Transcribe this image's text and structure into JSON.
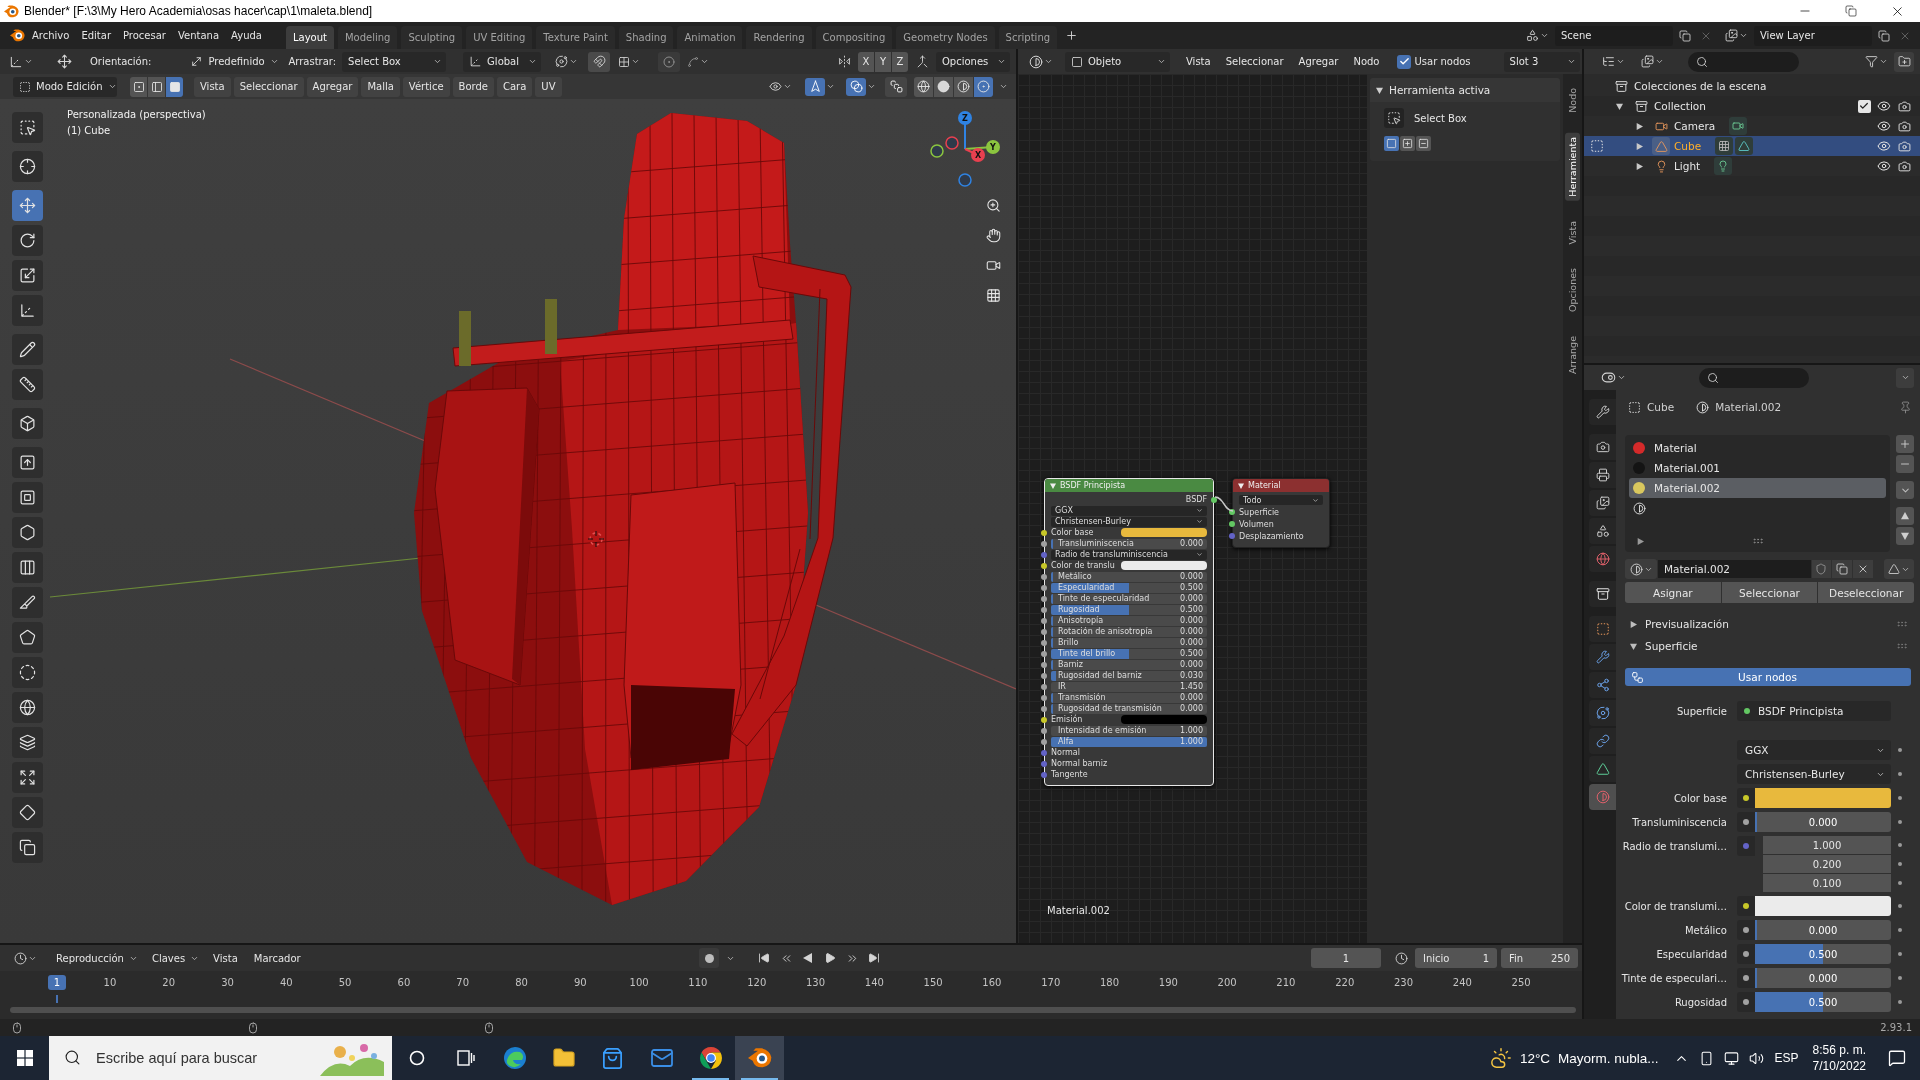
{
  "window": {
    "title": "Blender* [F:\\3\\My Hero Academia\\osas hacer\\cap\\1\\maleta.blend]"
  },
  "top_bar": {
    "menus": [
      "Archivo",
      "Editar",
      "Procesar",
      "Ventana",
      "Ayuda"
    ],
    "workspaces": [
      {
        "label": "Layout",
        "selected": true
      },
      {
        "label": "Modeling",
        "selected": false
      },
      {
        "label": "Sculpting",
        "selected": false
      },
      {
        "label": "UV Editing",
        "selected": false
      },
      {
        "label": "Texture Paint",
        "selected": false
      },
      {
        "label": "Shading",
        "selected": false
      },
      {
        "label": "Animation",
        "selected": false
      },
      {
        "label": "Rendering",
        "selected": false
      },
      {
        "label": "Compositing",
        "selected": false
      },
      {
        "label": "Geometry Nodes",
        "selected": false
      },
      {
        "label": "Scripting",
        "selected": false
      }
    ],
    "scene": "Scene",
    "view_layer": "View Layer"
  },
  "viewport": {
    "tool_settings": {
      "orientation_label": "Orientación:",
      "pivot": "Predefinido",
      "drag_label": "Arrastrar:",
      "drag": "Select Box",
      "orientation": "Global",
      "snap": false,
      "proportional": false,
      "mirror_axes": [
        {
          "label": "X",
          "selected": false
        },
        {
          "label": "Y",
          "selected": false
        },
        {
          "label": "Z",
          "selected": false
        }
      ],
      "options": "Opciones"
    },
    "header": {
      "mode": "Modo Edición",
      "select_modes": [
        {
          "kind": "vertex",
          "selected": false
        },
        {
          "kind": "edge",
          "selected": false
        },
        {
          "kind": "face",
          "selected": true
        }
      ],
      "menus": [
        "Vista",
        "Seleccionar",
        "Agregar",
        "Malla",
        "Vértice",
        "Borde",
        "Cara",
        "UV"
      ],
      "toggles": [
        {
          "kind": "gizmo",
          "on": true
        },
        {
          "kind": "overlay",
          "on": true
        },
        {
          "kind": "xray",
          "on": false
        }
      ],
      "shading": [
        {
          "kind": "wireframe",
          "selected": false
        },
        {
          "kind": "solid",
          "selected": false
        },
        {
          "kind": "material",
          "selected": false
        },
        {
          "kind": "rendered",
          "selected": true
        }
      ]
    },
    "overlay": {
      "view": "Personalizada (perspectiva)",
      "object": "(1) Cube"
    },
    "tool_groups": [
      [
        {
          "kind": "select_box",
          "selected": false
        }
      ],
      [
        {
          "kind": "cursor",
          "selected": false
        }
      ],
      [
        {
          "kind": "move",
          "selected": true
        },
        {
          "kind": "rotate",
          "selected": false
        },
        {
          "kind": "scale",
          "selected": false
        },
        {
          "kind": "transform",
          "selected": false
        }
      ],
      [
        {
          "kind": "annotate",
          "selected": false
        },
        {
          "kind": "measure",
          "selected": false
        }
      ],
      [
        {
          "kind": "add_cube",
          "selected": false
        }
      ],
      [
        {
          "kind": "extrude",
          "selected": false
        },
        {
          "kind": "inset",
          "selected": false
        },
        {
          "kind": "bevel",
          "selected": false
        },
        {
          "kind": "loop_cut",
          "selected": false
        },
        {
          "kind": "knife",
          "selected": false
        },
        {
          "kind": "poly_build",
          "selected": false
        },
        {
          "kind": "spin",
          "selected": false
        },
        {
          "kind": "smooth",
          "selected": false
        },
        {
          "kind": "edge_slide",
          "selected": false
        },
        {
          "kind": "shrink",
          "selected": false
        },
        {
          "kind": "shear",
          "selected": false
        },
        {
          "kind": "rip",
          "selected": false
        }
      ]
    ],
    "gizmo_axes": [
      {
        "label": "Z",
        "color": "#2f83e3"
      },
      {
        "label": "Y",
        "color": "#8bc53f"
      },
      {
        "label": "X",
        "color": "#e8404f"
      }
    ]
  },
  "node_editor": {
    "header": {
      "shader_type": "Objeto",
      "menus": [
        "Vista",
        "Seleccionar",
        "Agregar",
        "Nodo"
      ],
      "use_nodes": {
        "label": "Usar nodos",
        "checked": true
      },
      "slot": "Slot 3"
    },
    "nodes": [
      {
        "kind": "shader",
        "title": "BSDF Principista",
        "selected": true,
        "rows": [
          {
            "kind": "output",
            "label": "BSDF",
            "color": "#63c763"
          },
          {
            "kind": "dropdown",
            "label": "GGX"
          },
          {
            "kind": "dropdown",
            "label": "Christensen-Burley"
          },
          {
            "kind": "color",
            "label": "Color base",
            "color": "#c7c729",
            "swatch": {
              "color": "#e8b93d"
            }
          },
          {
            "kind": "slider",
            "label": "Transluminiscencia",
            "value": "0.000",
            "level": 0,
            "color": "#a1a1a1"
          },
          {
            "kind": "dropdown",
            "label": "Radio de transluminiscencia",
            "color": "#6363c7"
          },
          {
            "kind": "color",
            "label": "Color de translu",
            "color": "#c7c729",
            "swatch": {
              "color": "#ebebeb"
            }
          },
          {
            "kind": "slider",
            "label": "Metálico",
            "value": "0.000",
            "level": 0,
            "color": "#a1a1a1"
          },
          {
            "kind": "slider",
            "label": "Especularidad",
            "value": "0.500",
            "level": 0.5,
            "color": "#a1a1a1"
          },
          {
            "kind": "slider",
            "label": "Tinte de especularidad",
            "value": "0.000",
            "level": 0,
            "color": "#a1a1a1"
          },
          {
            "kind": "slider",
            "label": "Rugosidad",
            "value": "0.500",
            "level": 0.5,
            "color": "#a1a1a1"
          },
          {
            "kind": "slider",
            "label": "Anisotropía",
            "value": "0.000",
            "level": 0,
            "color": "#a1a1a1"
          },
          {
            "kind": "slider",
            "label": "Rotación de anisotropía",
            "value": "0.000",
            "level": 0,
            "color": "#a1a1a1"
          },
          {
            "kind": "slider",
            "label": "Brillo",
            "value": "0.000",
            "level": 0,
            "color": "#a1a1a1"
          },
          {
            "kind": "slider",
            "label": "Tinte del brillo",
            "value": "0.500",
            "level": 0.5,
            "color": "#a1a1a1"
          },
          {
            "kind": "slider",
            "label": "Barniz",
            "value": "0.000",
            "level": 0,
            "color": "#a1a1a1"
          },
          {
            "kind": "slider",
            "label": "Rugosidad del barniz",
            "value": "0.030",
            "level": 0.03,
            "color": "#a1a1a1"
          },
          {
            "kind": "number",
            "label": "IR",
            "value": "1.450",
            "color": "#a1a1a1"
          },
          {
            "kind": "slider",
            "label": "Transmisión",
            "value": "0.000",
            "level": 0,
            "color": "#a1a1a1"
          },
          {
            "kind": "slider",
            "label": "Rugosidad de transmisión",
            "value": "0.000",
            "level": 0,
            "color": "#a1a1a1"
          },
          {
            "kind": "color",
            "label": "Emisión",
            "color": "#c7c729",
            "swatch": {
              "color": "#000000"
            }
          },
          {
            "kind": "number",
            "label": "Intensidad de emisión",
            "value": "1.000",
            "color": "#a1a1a1"
          },
          {
            "kind": "slider",
            "label": "Alfa",
            "value": "1.000",
            "level": 1,
            "color": "#a1a1a1"
          },
          {
            "kind": "input",
            "label": "Normal",
            "color": "#6363c7"
          },
          {
            "kind": "input",
            "label": "Normal barniz",
            "color": "#6363c7"
          },
          {
            "kind": "input",
            "label": "Tangente",
            "color": "#6363c7"
          }
        ]
      },
      {
        "kind": "output",
        "title": "Material",
        "selected": false,
        "rows": [
          {
            "kind": "dropdown",
            "label": "Todo"
          },
          {
            "kind": "input",
            "label": "Superficie",
            "color": "#63c763"
          },
          {
            "kind": "input",
            "label": "Volumen",
            "color": "#63c763"
          },
          {
            "kind": "input",
            "label": "Desplazamiento",
            "color": "#6363c7"
          }
        ]
      }
    ],
    "material": "Material.002",
    "sidebar": {
      "panel_title": "Herramienta activa",
      "expanded": true,
      "tool": "Select Box",
      "modes": [
        {
          "kind": "set",
          "selected": true
        },
        {
          "kind": "extend",
          "selected": false
        },
        {
          "kind": "subtract",
          "selected": false
        }
      ]
    },
    "tabs": [
      {
        "label": "Nodo",
        "selected": false
      },
      {
        "label": "Herramienta",
        "selected": true
      },
      {
        "label": "Vista",
        "selected": false
      },
      {
        "label": "Opciones",
        "selected": false
      },
      {
        "label": "Arrange",
        "selected": false
      }
    ]
  },
  "timeline": {
    "menus": [
      {
        "label": "Reproducción",
        "kind": "dropdown"
      },
      {
        "label": "Claves",
        "kind": "dropdown"
      },
      {
        "label": "Vista",
        "kind": "menu"
      },
      {
        "label": "Marcador",
        "kind": "menu"
      }
    ],
    "auto_keying": false,
    "current_frame": "1",
    "start_label": "Inicio",
    "start": "1",
    "end_label": "Fin",
    "end": "250",
    "playhead": "1",
    "ruler": [
      "10",
      "20",
      "30",
      "40",
      "50",
      "60",
      "70",
      "80",
      "90",
      "100",
      "110",
      "120",
      "130",
      "140",
      "150",
      "160",
      "170",
      "180",
      "190",
      "200",
      "210",
      "220",
      "230",
      "240",
      "250"
    ]
  },
  "outliner": {
    "tree": [
      {
        "label": "Colecciones de la escena",
        "kind": "scene_collection",
        "selected": false,
        "children": [
          {
            "label": "Collection",
            "kind": "collection",
            "expanded": true,
            "included": true,
            "visible": true,
            "selected": false,
            "children": [
              {
                "label": "Camera",
                "kind": "camera",
                "expanded": false,
                "selected": false,
                "edit_mode": false,
                "visible": true
              },
              {
                "label": "Cube",
                "kind": "mesh",
                "expanded": false,
                "selected": true,
                "edit_mode": true,
                "visible": true
              },
              {
                "label": "Light",
                "kind": "light",
                "expanded": false,
                "selected": false,
                "edit_mode": false,
                "visible": true
              }
            ]
          }
        ]
      }
    ]
  },
  "properties": {
    "tab_groups": [
      [
        {
          "kind": "tool",
          "selected": false
        }
      ],
      [
        {
          "kind": "render",
          "selected": false
        },
        {
          "kind": "output",
          "selected": false
        },
        {
          "kind": "view_layer",
          "selected": false
        },
        {
          "kind": "scene",
          "selected": false
        },
        {
          "kind": "world",
          "selected": false
        }
      ],
      [
        {
          "kind": "collection",
          "selected": false
        }
      ],
      [
        {
          "kind": "object",
          "selected": false
        },
        {
          "kind": "modifiers",
          "selected": false
        },
        {
          "kind": "particles",
          "selected": false
        },
        {
          "kind": "physics",
          "selected": false
        },
        {
          "kind": "constraints",
          "selected": false
        },
        {
          "kind": "data",
          "selected": false
        },
        {
          "kind": "material",
          "selected": true
        }
      ]
    ],
    "breadcrumb": [
      {
        "kind": "object",
        "label": "Cube"
      },
      {
        "kind": "material",
        "label": "Material.002"
      }
    ],
    "slots": [
      {
        "kind": "material",
        "label": "Material",
        "color": "#d42a2a",
        "selected": false
      },
      {
        "kind": "material",
        "label": "Material.001",
        "color": "#141414",
        "selected": false
      },
      {
        "kind": "material",
        "label": "Material.002",
        "color": "#d9c75e",
        "selected": true
      },
      {
        "kind": "empty",
        "selected": false
      }
    ],
    "material": "Material.002",
    "slot_actions": [
      "Asignar",
      "Seleccionar",
      "Deseleccionar"
    ],
    "panels": [
      {
        "title": "Previsualización",
        "expanded": false
      },
      {
        "title": "Superficie",
        "expanded": true,
        "use_nodes": "Usar nodos",
        "surface": {
          "label": "Superficie",
          "value": "BSDF Principista",
          "color": "#63c763"
        },
        "fields": [
          {
            "kind": "dropdown",
            "value": "GGX"
          },
          {
            "kind": "dropdown",
            "value": "Christensen-Burley"
          },
          {
            "kind": "color",
            "label": "Color base",
            "color": "#c7c729",
            "swatch": {
              "color": "#e8b93d"
            }
          },
          {
            "kind": "slider",
            "label": "Transluminiscencia",
            "color": "#a1a1a1",
            "value": "0.000",
            "level": 0
          },
          {
            "kind": "vector",
            "label": "Radio de translumi…",
            "color": "#6363c7",
            "values": [
              "1.000",
              "0.200",
              "0.100"
            ]
          },
          {
            "kind": "color",
            "label": "Color de translumi…",
            "color": "#c7c729",
            "swatch": {
              "color": "#ebebeb"
            }
          },
          {
            "kind": "slider",
            "label": "Metálico",
            "color": "#a1a1a1",
            "value": "0.000",
            "level": 0
          },
          {
            "kind": "slider",
            "label": "Especularidad",
            "color": "#a1a1a1",
            "value": "0.500",
            "level": 0.5
          },
          {
            "kind": "slider",
            "label": "Tinte de especulari…",
            "color": "#a1a1a1",
            "value": "0.000",
            "level": 0
          },
          {
            "kind": "slider",
            "label": "Rugosidad",
            "color": "#a1a1a1",
            "value": "0.500",
            "level": 0.5
          }
        ]
      }
    ]
  },
  "status_bar": {
    "version": "2.93.1"
  },
  "taskbar": {
    "search": {
      "placeholder": "Escribe aquí para buscar"
    },
    "apps": [
      {
        "kind": "assistant",
        "running": false,
        "active": false
      },
      {
        "kind": "task_view",
        "running": false,
        "active": false
      },
      {
        "kind": "edge",
        "running": false,
        "active": false
      },
      {
        "kind": "files",
        "running": false,
        "active": false
      },
      {
        "kind": "store",
        "running": false,
        "active": false
      },
      {
        "kind": "mail",
        "running": false,
        "active": false
      },
      {
        "kind": "chrome",
        "running": true,
        "active": false
      },
      {
        "kind": "blender",
        "running": true,
        "active": true
      }
    ],
    "weather": {
      "temperature": "12°C",
      "condition": "Mayorm. nubla..."
    },
    "language": "ESP",
    "time": "8:56 p. m.",
    "date": "7/10/2022"
  }
}
